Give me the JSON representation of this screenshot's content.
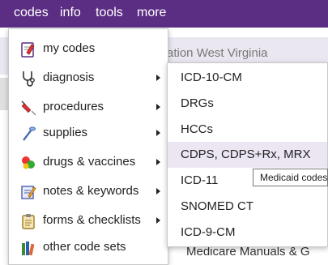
{
  "nav": {
    "codes": "codes",
    "info": "info",
    "tools": "tools",
    "more": "more"
  },
  "background": {
    "fragment_top": "ation   West Virginia",
    "fragment_bottom": "Medicare Manuals & G"
  },
  "menu": {
    "items": [
      {
        "label": "my codes",
        "icon": "notepad-check-icon",
        "has_submenu": false
      },
      {
        "label": "diagnosis",
        "icon": "stethoscope-icon",
        "has_submenu": true
      },
      {
        "label": "procedures",
        "icon": "syringe-icon",
        "has_submenu": true
      },
      {
        "label": "supplies",
        "icon": "crutch-icon",
        "has_submenu": true
      },
      {
        "label": "drugs & vaccines",
        "icon": "pills-icon",
        "has_submenu": true
      },
      {
        "label": "notes & keywords",
        "icon": "note-pencil-icon",
        "has_submenu": true
      },
      {
        "label": "forms & checklists",
        "icon": "clipboard-icon",
        "has_submenu": true
      },
      {
        "label": "other code sets",
        "icon": "books-icon",
        "has_submenu": false
      }
    ]
  },
  "submenu": {
    "items": [
      {
        "label": "ICD-10-CM"
      },
      {
        "label": "DRGs"
      },
      {
        "label": "HCCs"
      },
      {
        "label": "CDPS, CDPS+Rx, MRX",
        "active": true
      },
      {
        "label": "ICD-11"
      },
      {
        "label": "SNOMED CT"
      },
      {
        "label": "ICD-9-CM"
      }
    ]
  },
  "tooltip": "Medicaid codes",
  "colors": {
    "nav_bg": "#5b2d83",
    "hover_bg": "#ece6f3"
  }
}
